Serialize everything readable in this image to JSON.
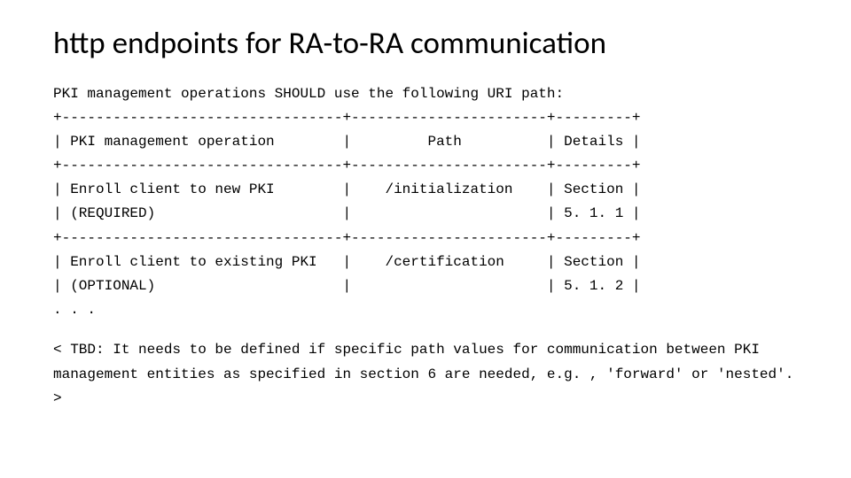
{
  "title": "http endpoints for RA-to-RA communication",
  "intro": "PKI management operations SHOULD use the following URI path:",
  "tbd": "< TBD: It needs to be defined if specific path values for communication between PKI management entities as specified in section 6 are needed, e.g. , 'forward' or 'nested'. >",
  "ellipsis": ". . .",
  "border": "+---------------------------------+-----------------------+---------+",
  "headerRow": "| PKI management operation        |         Path          | Details |",
  "row1a": "| Enroll client to new PKI        |    /initialization    | Section |",
  "row1b": "| (REQUIRED)                      |                       | 5. 1. 1 |",
  "row2a": "| Enroll client to existing PKI   |    /certification     | Section |",
  "row2b": "| (OPTIONAL)                      |                       | 5. 1. 2 |"
}
